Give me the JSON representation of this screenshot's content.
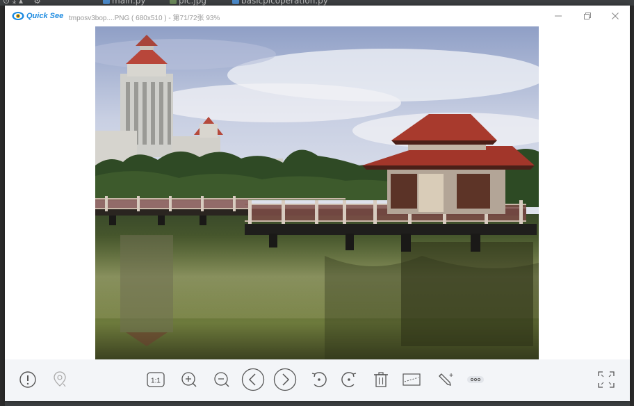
{
  "ide": {
    "tabs": [
      {
        "label": "main.py",
        "icon": "python-file-icon"
      },
      {
        "label": "pic.jpg",
        "icon": "image-file-icon"
      },
      {
        "label": "basicpicoperation.py",
        "icon": "python-file-icon"
      }
    ]
  },
  "viewer": {
    "app_name": "Quick See",
    "title": "tmposv3bop....PNG ( 680x510 ) - 第71/72张 93%",
    "window_controls": [
      "minimize-icon",
      "restore-icon",
      "close-icon"
    ],
    "toolbar": {
      "left": [
        "info-icon",
        "location-pin-icon"
      ],
      "center": [
        {
          "icon": "actual-size-icon",
          "label": "1:1"
        },
        {
          "icon": "zoom-in-icon"
        },
        {
          "icon": "zoom-out-icon"
        },
        {
          "icon": "previous-icon"
        },
        {
          "icon": "next-icon"
        },
        {
          "icon": "rotate-left-icon"
        },
        {
          "icon": "rotate-right-icon"
        },
        {
          "icon": "delete-icon"
        },
        {
          "icon": "crop-icon"
        },
        {
          "icon": "edit-icon"
        },
        {
          "icon": "more-icon"
        }
      ],
      "right": [
        "fullscreen-icon"
      ]
    },
    "colors": {
      "accent": "#1b8ae0",
      "toolbar_bg": "#f3f5f8",
      "icon": "#555555"
    }
  }
}
